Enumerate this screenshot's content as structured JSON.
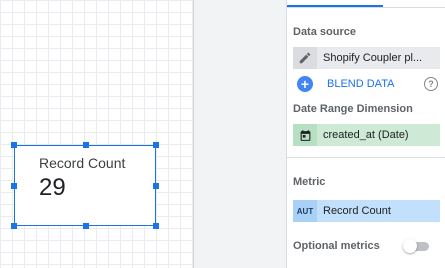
{
  "scorecard": {
    "label": "Record Count",
    "value": "29"
  },
  "panel": {
    "data_source": {
      "title": "Data source",
      "name": "Shopify Coupler pl...",
      "icon": "pencil-icon"
    },
    "blend": {
      "label": "BLEND DATA",
      "icon": "plus-icon",
      "help_icon": "help-icon"
    },
    "date_range": {
      "title": "Date Range Dimension",
      "field": "created_at (Date)",
      "icon": "calendar-icon"
    },
    "metric": {
      "title": "Metric",
      "type_badge": "AUT",
      "field": "Record Count"
    },
    "optional_metrics": {
      "label": "Optional metrics",
      "enabled": false
    }
  },
  "colors": {
    "accent": "#1a73e8",
    "date_chip": "#ceead6",
    "metric_chip": "#c2e0fb",
    "source_chip": "#e8eaed"
  }
}
